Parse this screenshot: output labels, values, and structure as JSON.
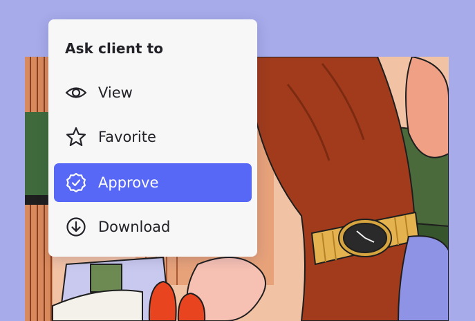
{
  "menu": {
    "title": "Ask client to",
    "items": [
      {
        "label": "View",
        "icon": "eye-icon",
        "active": false
      },
      {
        "label": "Favorite",
        "icon": "star-icon",
        "active": false
      },
      {
        "label": "Approve",
        "icon": "badge-check-icon",
        "active": true
      },
      {
        "label": "Download",
        "icon": "download-circle-icon",
        "active": false
      }
    ]
  },
  "colors": {
    "background": "#a7abea",
    "accent": "#5767f6",
    "menu_background": "#f7f7f7",
    "text": "#222228",
    "active_text": "#ffffff"
  }
}
